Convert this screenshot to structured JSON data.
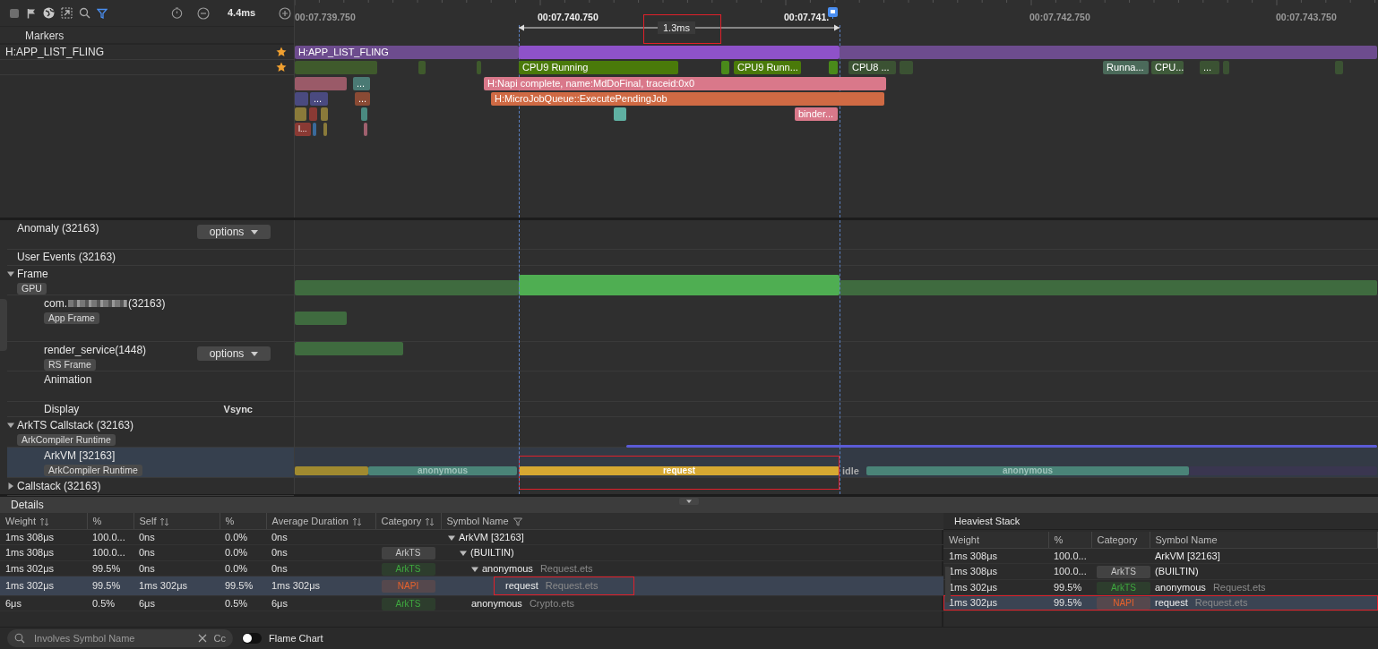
{
  "toolbar": {
    "zoom_level": "4.4ms"
  },
  "ruler": {
    "ticks": [
      "00:07.739.750",
      "00:07.740.750",
      "00:07.741.",
      "00:07.742.750",
      "00:07.743.750"
    ],
    "selection": {
      "duration": "1.3ms",
      "highlighted": true
    }
  },
  "markers": {
    "label": "Markers"
  },
  "trace_tracks": [
    {
      "name": "H:APP_LIST_FLING",
      "starred": true
    },
    {
      "starred": true
    }
  ],
  "trace_rows": [
    [
      {
        "label": "H:APP_LIST_FLING",
        "color": "#6d4c8e"
      },
      {
        "color": "#8e52c9"
      },
      {
        "color": "#6d4c8e"
      }
    ],
    [
      {
        "color": "#3f5a2c"
      },
      {
        "color": "#3f5a2c"
      },
      {
        "color": "#3f5a2c"
      },
      {
        "label": "CPU9 Running",
        "color": "#4a7a0a"
      },
      {
        "color": "#4a8a1a"
      },
      {
        "label": "CPU9 Runn...",
        "color": "#4a7a0a"
      },
      {
        "color": "#4a8a1a"
      },
      {
        "label": "CPU8 ...",
        "color": "#3b5233"
      },
      {
        "color": "#3b5233"
      },
      {
        "label": "Runna...",
        "color": "#4b6a5a"
      },
      {
        "label": "CPU...",
        "color": "#3f5a3a"
      },
      {
        "label": "...",
        "color": "#3b5233"
      },
      {
        "color": "#3b5233"
      },
      {
        "color": "#3b5233"
      }
    ],
    [
      {
        "color": "#9a5a68"
      },
      {
        "label": "...",
        "color": "#4a7a74"
      },
      {
        "label": "H:Napi complete, name:MdDoFinal, traceid:0x0",
        "color": "#d9788a"
      }
    ],
    [
      {
        "color": "#4a4a80"
      },
      {
        "label": "...",
        "color": "#4a4a80"
      },
      {
        "label": "...",
        "color": "#8a4a34"
      },
      {
        "label": "H:MicroJobQueue::ExecutePendingJob",
        "color": "#cf6a44"
      }
    ],
    [
      {
        "color": "#8a7a3a"
      },
      {
        "color": "#8a3a34"
      },
      {
        "color": "#8a7a3a"
      },
      {
        "color": "#4a8a80"
      },
      {
        "color": "#5fb0a2"
      },
      {
        "label": "binder...",
        "color": "#d9788a"
      }
    ],
    [
      {
        "label": "l...",
        "color": "#8a3a34"
      },
      {
        "color": "#3a6a9a"
      },
      {
        "color": "#8a7a3a"
      },
      {
        "color": "#a0606e"
      }
    ]
  ],
  "lower_tracks": [
    {
      "name": "Anomaly (32163)",
      "options": "options",
      "selected": false
    },
    {
      "name": "User Events (32163)",
      "selected": false
    },
    {
      "name": "Frame",
      "expanded": true,
      "tag": "GPU",
      "selected": false,
      "slices": [
        {
          "color": "#3f6b3f"
        },
        {
          "color": "#4fae52"
        },
        {
          "color": "#3f6b3f"
        }
      ],
      "children": [
        {
          "name": "com.",
          "name_end": "(32163)",
          "redacted": true,
          "tag": "App Frame",
          "selected": false,
          "slices": [
            {
              "color": "#3f6b3f"
            }
          ]
        },
        {
          "name": "render_service(1448)",
          "tag": "RS Frame",
          "options": "options",
          "selected": false,
          "slices": [
            {
              "color": "#3f6b3f"
            }
          ]
        },
        {
          "name": "Animation",
          "selected": false
        },
        {
          "name": "Display",
          "note": "Vsync",
          "selected": false
        }
      ]
    },
    {
      "name": "ArkTS Callstack (32163)",
      "expanded": true,
      "tag": "ArkCompiler Runtime",
      "selected": false,
      "slices": [
        {
          "color": "#5b5bd6"
        }
      ],
      "children": [
        {
          "name": "ArkVM [32163]",
          "tag": "ArkCompiler Runtime",
          "selected": true,
          "slices": [
            {
              "kind": "slice",
              "color": "#a08a30"
            },
            {
              "kind": "slice",
              "label": "anonymous",
              "color": "#4a8478"
            },
            {
              "kind": "slice",
              "label": "request",
              "color": "#d6a832",
              "highlighted": true
            },
            {
              "kind": "gap",
              "label": "idle"
            },
            {
              "kind": "slice",
              "label": "anonymous",
              "color": "#4a8478"
            },
            {
              "kind": "slice",
              "color": "#3a3650"
            }
          ]
        }
      ]
    },
    {
      "name": "Callstack (32163)",
      "expanded": false,
      "selected": false
    }
  ],
  "details": {
    "title": "Details",
    "columns": [
      {
        "label": "Weight",
        "sortable": true
      },
      {
        "label": "%"
      },
      {
        "label": "Self",
        "sortable": true
      },
      {
        "label": "%"
      },
      {
        "label": "Average Duration",
        "sortable": true
      },
      {
        "label": "Category",
        "sortable": true
      },
      {
        "label": "Symbol Name",
        "filterable": true
      }
    ],
    "tree": [
      {
        "weight": "1ms 308μs",
        "weight_pct": "100.0...",
        "self": "0ns",
        "self_pct": "0.0%",
        "average": "0ns",
        "symbol": "ArkVM [32163]",
        "expanded": true,
        "selected": false,
        "children": [
          {
            "weight": "1ms 308μs",
            "weight_pct": "100.0...",
            "self": "0ns",
            "self_pct": "0.0%",
            "average": "0ns",
            "category": {
              "label": "ArkTS",
              "color": "#c8c8c8"
            },
            "symbol": "(BUILTIN)",
            "expanded": true,
            "selected": false,
            "children": [
              {
                "weight": "1ms 302μs",
                "weight_pct": "99.5%",
                "self": "0ns",
                "self_pct": "0.0%",
                "average": "0ns",
                "category": {
                  "label": "ArkTS",
                  "color": "#3fa83f"
                },
                "symbol": "anonymous",
                "file": "Request.ets",
                "expanded": true,
                "selected": false,
                "children": [
                  {
                    "weight": "1ms 302μs",
                    "weight_pct": "99.5%",
                    "self": "1ms 302μs",
                    "self_pct": "99.5%",
                    "average": "1ms 302μs",
                    "category": {
                      "label": "NAPI",
                      "color": "#e8622c"
                    },
                    "symbol": "request",
                    "file": "Request.ets",
                    "selected": true,
                    "highlighted": true
                  }
                ]
              },
              {
                "weight": "6μs",
                "weight_pct": "0.5%",
                "self": "6μs",
                "self_pct": "0.5%",
                "average": "6μs",
                "category": {
                  "label": "ArkTS",
                  "color": "#3fa83f"
                },
                "symbol": "anonymous",
                "file": "Crypto.ets",
                "selected": false
              }
            ]
          }
        ]
      }
    ]
  },
  "heaviest": {
    "title": "Heaviest Stack",
    "columns": [
      "Weight",
      "%",
      "Category",
      "Symbol Name"
    ],
    "rows": [
      {
        "weight": "1ms 308μs",
        "pct": "100.0...",
        "symbol": "ArkVM [32163]",
        "selected": false
      },
      {
        "weight": "1ms 308μs",
        "pct": "100.0...",
        "category": {
          "label": "ArkTS",
          "color": "#c8c8c8"
        },
        "symbol": "(BUILTIN)",
        "selected": false
      },
      {
        "weight": "1ms 302μs",
        "pct": "99.5%",
        "category": {
          "label": "ArkTS",
          "color": "#3fa83f"
        },
        "symbol": "anonymous",
        "file": "Request.ets",
        "selected": false
      },
      {
        "weight": "1ms 302μs",
        "pct": "99.5%",
        "category": {
          "label": "NAPI",
          "color": "#e8622c"
        },
        "symbol": "request",
        "file": "Request.ets",
        "selected": true,
        "highlighted": true
      }
    ]
  },
  "search": {
    "placeholder": "Involves Symbol Name",
    "case_button": "Cc"
  },
  "flame_chart": {
    "label": "Flame Chart",
    "on": false
  }
}
